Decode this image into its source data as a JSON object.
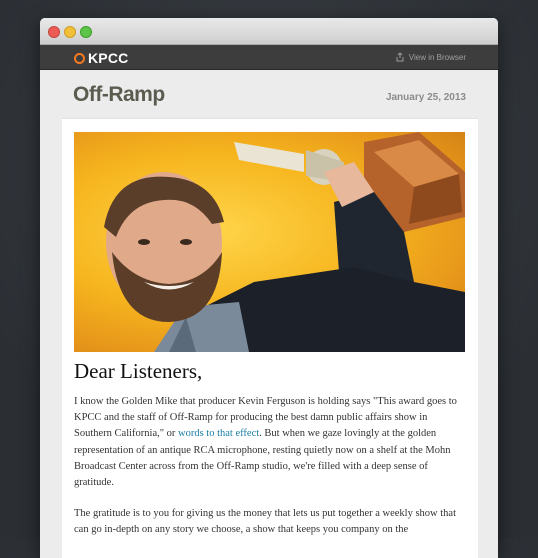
{
  "header": {
    "brand": "KPCC",
    "view_in_browser": "View in Browser"
  },
  "masthead": {
    "logo_text": "Off-Ramp",
    "date": "January 25, 2013"
  },
  "article": {
    "headline": "Dear Listeners,",
    "p1_before": "I know the Golden Mike that producer Kevin Ferguson is holding says \"This award goes to KPCC and the staff of Off-Ramp for producing the best damn public affairs show in Southern California,\" or ",
    "p1_link": "words to that effect",
    "p1_after": ". But when we gaze lovingly at the golden representation of an antique RCA microphone, resting quietly now on a shelf at the Mohn Broadcast Center across from the Off-Ramp studio, we're filled with a deep sense of gratitude.",
    "p2": "The gratitude is to you for giving us the money that lets us put together a weekly show that can go in-depth on any story we choose, a show that keeps you company on the"
  },
  "colors": {
    "kpcc_orange": "#f47920",
    "link_blue": "#1a7fa6",
    "hero_yellow": "#f6b51e"
  }
}
